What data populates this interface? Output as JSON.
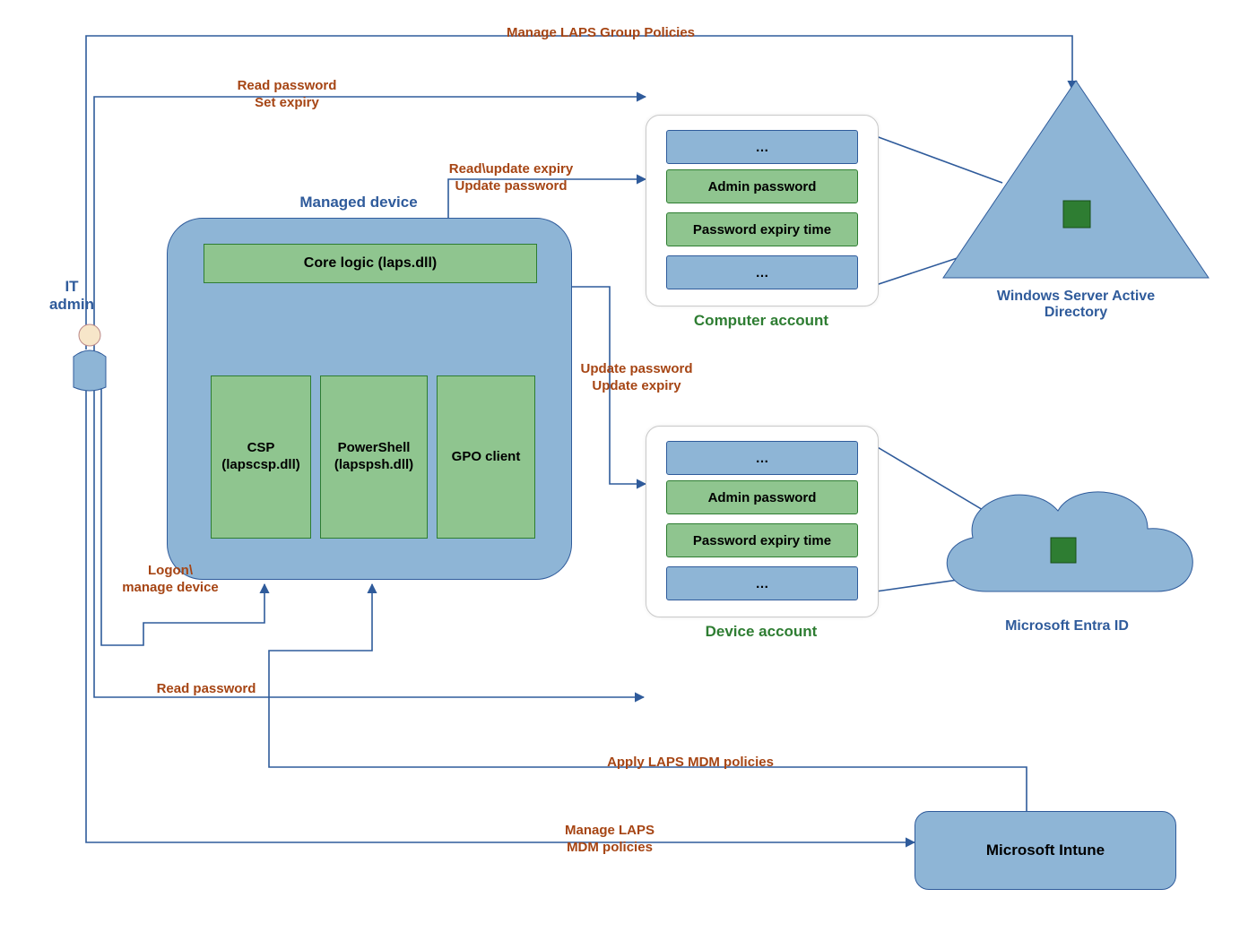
{
  "roles": {
    "it_admin": "IT\nadmin"
  },
  "managed_device": {
    "title": "Managed device",
    "core_logic": "Core logic (laps.dll)",
    "csp": "CSP\n(lapscsp.dll)",
    "powershell": "PowerShell\n(lapspsh.dll)",
    "gpo_client": "GPO client"
  },
  "computer_account": {
    "title": "Computer account",
    "rows": [
      "…",
      "Admin password",
      "Password expiry time",
      "…"
    ]
  },
  "device_account": {
    "title": "Device account",
    "rows": [
      "…",
      "Admin password",
      "Password expiry time",
      "…"
    ]
  },
  "directories": {
    "ad": "Windows Server Active\nDirectory",
    "entra": "Microsoft Entra ID"
  },
  "intune": "Microsoft Intune",
  "labels": {
    "manage_gpo": "Manage LAPS Group Policies",
    "read_set": "Read password\nSet expiry",
    "read_update": "Read\\update expiry\nUpdate password",
    "update_entra": "Update password\nUpdate expiry",
    "logon": "Logon\\\nmanage device",
    "read_pw": "Read password",
    "apply_mdm": "Apply LAPS MDM policies",
    "manage_mdm": "Manage LAPS\nMDM policies"
  },
  "colors": {
    "blue_fill": "#8EB5D6",
    "blue_stroke": "#2F5B9B",
    "green_fill": "#8FC58F",
    "green_stroke": "#2E7D32",
    "brown": "#A64514"
  }
}
